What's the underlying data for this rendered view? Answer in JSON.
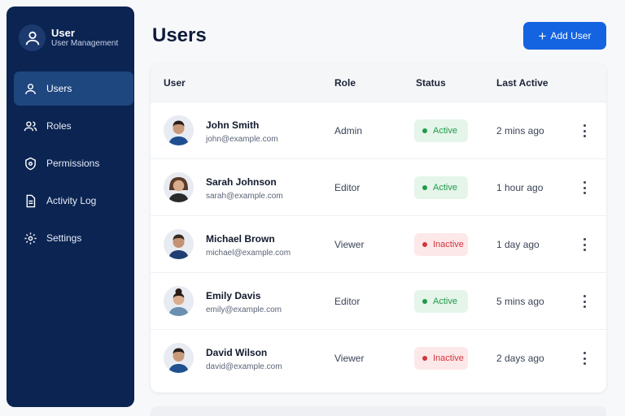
{
  "brand": {
    "title": "User",
    "subtitle": "User Management",
    "icon": "user-icon"
  },
  "sidebar": {
    "items": [
      {
        "label": "Users",
        "icon": "user-icon",
        "active": true
      },
      {
        "label": "Roles",
        "icon": "users-icon",
        "active": false
      },
      {
        "label": "Permissions",
        "icon": "shield-icon",
        "active": false
      },
      {
        "label": "Activity Log",
        "icon": "document-icon",
        "active": false
      },
      {
        "label": "Settings",
        "icon": "gear-icon",
        "active": false
      }
    ]
  },
  "header": {
    "title": "Users",
    "add_label": "Add User"
  },
  "table": {
    "columns": {
      "user": "User",
      "role": "Role",
      "status": "Status",
      "last_active": "Last Active"
    },
    "rows": [
      {
        "name": "John Smith",
        "email": "john@example.com",
        "role": "Admin",
        "status": "Active",
        "last_active": "2 mins ago"
      },
      {
        "name": "Sarah Johnson",
        "email": "sarah@example.com",
        "role": "Editor",
        "status": "Active",
        "last_active": "1 hour ago"
      },
      {
        "name": "Michael Brown",
        "email": "michael@example.com",
        "role": "Viewer",
        "status": "Inactive",
        "last_active": "1 day ago"
      },
      {
        "name": "Emily Davis",
        "email": "emily@example.com",
        "role": "Editor",
        "status": "Active",
        "last_active": "5 mins ago"
      },
      {
        "name": "David Wilson",
        "email": "david@example.com",
        "role": "Viewer",
        "status": "Inactive",
        "last_active": "2 days ago"
      }
    ]
  },
  "colors": {
    "sidebar": "#0b2452",
    "accent": "#1463e0",
    "active": "#1f9a4b",
    "inactive": "#d3343d"
  }
}
